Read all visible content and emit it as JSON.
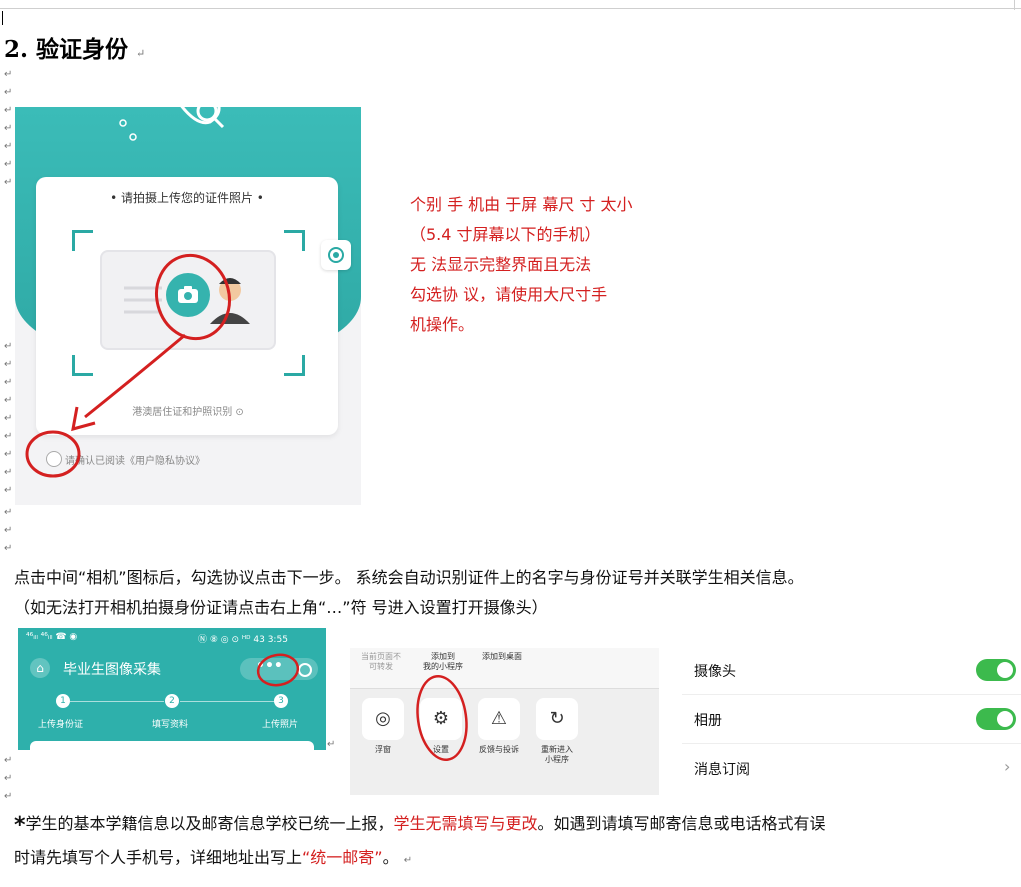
{
  "heading": {
    "number": "2.",
    "text": "验证身份"
  },
  "screenshot1": {
    "card_title": "• 请拍摄上传您的证件照片 •",
    "hint": "港澳居住证和护照识别 ⊙",
    "agree": "请确认已阅读《用户隐私协议》"
  },
  "side_note": [
    "个别 手 机由 于屏 幕尺 寸 太小",
    "（5.4   寸屏幕以下的手机）",
    "无  法显示完整界面且无法",
    "勾选协  议，请使用大尺寸手",
    "机操作。"
  ],
  "instruction": {
    "line1": "点击中间“相机”图标后，勾选协议点击下一步。  系统会自动识别证件上的名字与身份证号并关联学生相关信息。",
    "line2": "（如无法打开相机拍摄身份证请点击右上角“…”符  号进入设置打开摄像头）"
  },
  "screenshot2": {
    "status_left": "⁴⁶ᵢₗₗ ⁴⁶ᵢₗₗ ☎ ◉",
    "status_right": "Ⓝ ⑧ ◎ ⊙ ᴴᴰ 43 3:55",
    "title": "毕业生图像采集",
    "dots": "•••",
    "steps": [
      {
        "num": "1",
        "label": "上传身份证"
      },
      {
        "num": "2",
        "label": "填写资料"
      },
      {
        "num": "3",
        "label": "上传照片"
      }
    ]
  },
  "screenshot3": {
    "top_items": [
      "当前页面不\n可转发",
      "添加到\n我的小程序",
      "添加到桌面"
    ],
    "tiles": [
      {
        "icon": "◎",
        "label": "浮窗"
      },
      {
        "icon": "⚙",
        "label": "设置"
      },
      {
        "icon": "⚠",
        "label": "反馈与投诉"
      },
      {
        "icon": "↻",
        "label": "重新进入\n小程序"
      }
    ]
  },
  "settings": [
    {
      "label": "摄像头",
      "state": "on"
    },
    {
      "label": "相册",
      "state": "on"
    },
    {
      "label": "消息订阅",
      "chevron": "›"
    }
  ],
  "footnote": {
    "star": "*",
    "seg1": "学生的基本学籍信息以及邮寄信息学校已统一上报，",
    "seg2_red": "学生无需填写与更改",
    "seg3": "。如遇到请填写邮寄信息或电话格式有误",
    "line2_a": "时请先填写个人手机号，详细地址出写上",
    "line2_red": "“统一邮寄”",
    "line2_end": "。"
  },
  "colors": {
    "teal": "#2eb0ab",
    "annotation_red": "#d42020",
    "toggle_green": "#3cba4d"
  },
  "paragraph_mark": "↵"
}
